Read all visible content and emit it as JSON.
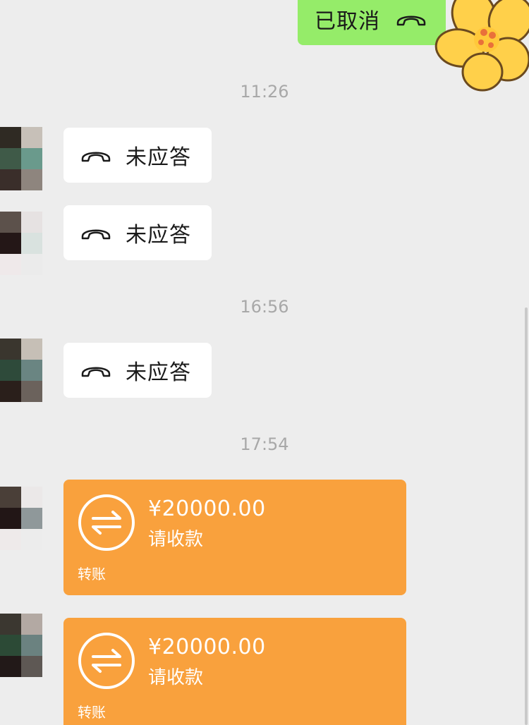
{
  "outgoing": {
    "text": "已取消",
    "icon": "phone-hangup-icon"
  },
  "timestamps": [
    "11:26",
    "16:56",
    "17:54"
  ],
  "missed_calls": [
    {
      "text": "未应答",
      "icon": "phone-hangup-icon"
    },
    {
      "text": "未应答",
      "icon": "phone-hangup-icon"
    },
    {
      "text": "未应答",
      "icon": "phone-hangup-icon"
    }
  ],
  "transfers": [
    {
      "amount": "¥20000.00",
      "status": "请收款",
      "label": "转账",
      "icon": "transfer-arrows-icon"
    },
    {
      "amount": "¥20000.00",
      "status": "请收款",
      "label": "转账",
      "icon": "transfer-arrows-icon"
    }
  ],
  "colors": {
    "background": "#ededed",
    "outgoing_bubble": "#95ec69",
    "incoming_bubble": "#ffffff",
    "transfer_card": "#f9a13d",
    "timestamp": "#a8a8a8"
  }
}
